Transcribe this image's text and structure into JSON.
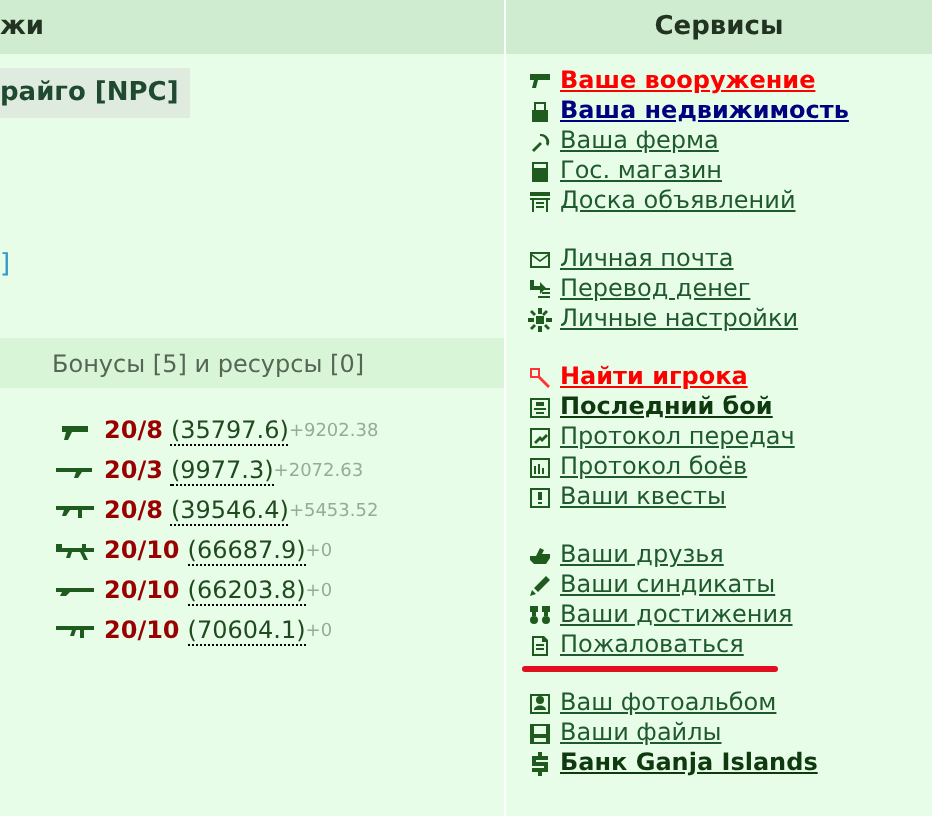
{
  "left_header": {
    "title": "жи"
  },
  "npc_label": "райго [NPC]",
  "bracket_text": "]",
  "bonus_bar": {
    "text": "Бонусы [5] и ресурсы [0]"
  },
  "weapons": [
    {
      "level": "20/8",
      "value": "(35797.6)",
      "bonus": "+9202.38"
    },
    {
      "level": "20/3",
      "value": "(9977.3)",
      "bonus": "+2072.63"
    },
    {
      "level": "20/8",
      "value": "(39546.4)",
      "bonus": "+5453.52"
    },
    {
      "level": "20/10",
      "value": "(66687.9)",
      "bonus": "+0"
    },
    {
      "level": "20/10",
      "value": "(66203.8)",
      "bonus": "+0"
    },
    {
      "level": "20/10",
      "value": "(70604.1)",
      "bonus": "+0"
    }
  ],
  "services": {
    "title": "Сервисы",
    "groups": [
      [
        {
          "label": "Ваше вооружение",
          "kind": "alert"
        },
        {
          "label": "Ваша недвижимость",
          "kind": "primary"
        },
        {
          "label": "Ваша ферма",
          "kind": "normal"
        },
        {
          "label": "Гос. магазин",
          "kind": "normal"
        },
        {
          "label": "Доска объявлений",
          "kind": "normal"
        }
      ],
      [
        {
          "label": "Личная почта",
          "kind": "normal"
        },
        {
          "label": "Перевод денег",
          "kind": "normal"
        },
        {
          "label": "Личные настройки",
          "kind": "normal"
        }
      ],
      [
        {
          "label": "Найти игрока",
          "kind": "alert"
        },
        {
          "label": "Последний бой",
          "kind": "bold"
        },
        {
          "label": "Протокол передач",
          "kind": "normal"
        },
        {
          "label": "Протокол боёв",
          "kind": "normal"
        },
        {
          "label": "Ваши квесты",
          "kind": "normal"
        }
      ],
      [
        {
          "label": "Ваши друзья",
          "kind": "normal"
        },
        {
          "label": "Ваши синдикаты",
          "kind": "normal"
        },
        {
          "label": "Ваши достижения",
          "kind": "normal"
        },
        {
          "label": "Пожаловаться",
          "kind": "normal",
          "marked": true
        }
      ],
      [
        {
          "label": "Ваш фотоальбом",
          "kind": "normal"
        },
        {
          "label": "Ваши файлы",
          "kind": "normal"
        },
        {
          "label": "Банк Ganja Islands",
          "kind": "bold"
        }
      ]
    ]
  }
}
